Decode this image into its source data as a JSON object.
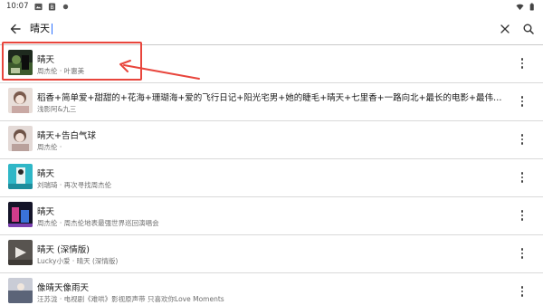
{
  "status_bar": {
    "time": "10:07"
  },
  "search": {
    "query": "晴天"
  },
  "results": [
    {
      "title": "晴天",
      "subtitle": "周杰伦 · 叶惠美"
    },
    {
      "title": "稻香+简单爱+甜甜的+花海+珊瑚海+爱的飞行日记+阳光宅男+她的睫毛+晴天+七里香+一路向北+最长的电影+最伟大的作品+...",
      "subtitle": "浅影阿&九三"
    },
    {
      "title": "晴天+告白气球",
      "subtitle": "周杰伦 ·"
    },
    {
      "title": "晴天",
      "subtitle": "刘瑞琦 · 再次寻找周杰伦"
    },
    {
      "title": "晴天",
      "subtitle": "周杰伦 · 周杰伦地表最强世界巡回演唱会"
    },
    {
      "title": "晴天 (深情版)",
      "subtitle": "Lucky小爱 · 晴天 (深情版)"
    },
    {
      "title": "像晴天像雨天",
      "subtitle": "汪苏泷 · 电视剧《难哄》影视原声带 只喜欢你Love Moments"
    }
  ],
  "colors": {
    "highlight": "#e8453c",
    "caret": "#2b6fff"
  }
}
